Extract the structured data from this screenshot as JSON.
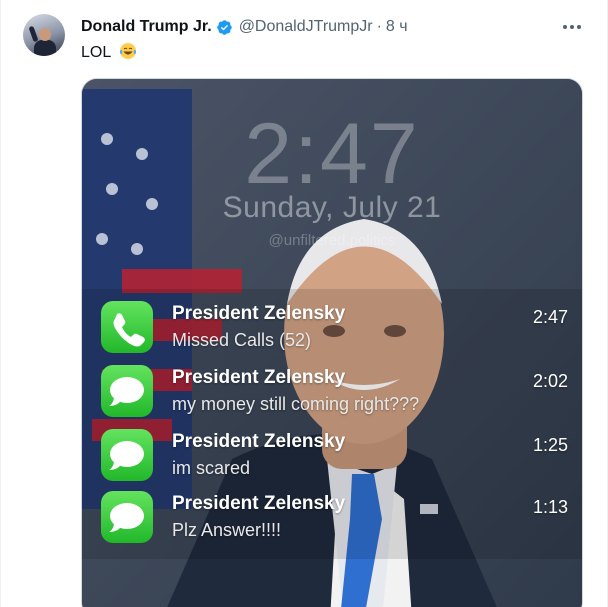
{
  "tweet": {
    "author_name": "Donald Trump Jr.",
    "handle": "@DonaldJTrumpJr",
    "separator": "·",
    "time": "8 ч",
    "text": "LOL",
    "emoji": "face-with-tears-of-joy",
    "verified_color": "#1d9bf0"
  },
  "image": {
    "lock_time": "2:47",
    "lock_date": "Sunday, July 21",
    "watermark": "@unfiltered.politics",
    "notifications": [
      {
        "app": "phone",
        "title": "President Zelensky",
        "body": "Missed Calls (52)",
        "time": "2:47"
      },
      {
        "app": "messages",
        "title": "President Zelensky",
        "body": "my money still coming right???",
        "time": "2:02"
      },
      {
        "app": "messages",
        "title": "President Zelensky",
        "body": "im scared",
        "time": "1:25"
      },
      {
        "app": "messages",
        "title": "President Zelensky",
        "body": "Plz Answer!!!!",
        "time": "1:13"
      }
    ]
  }
}
